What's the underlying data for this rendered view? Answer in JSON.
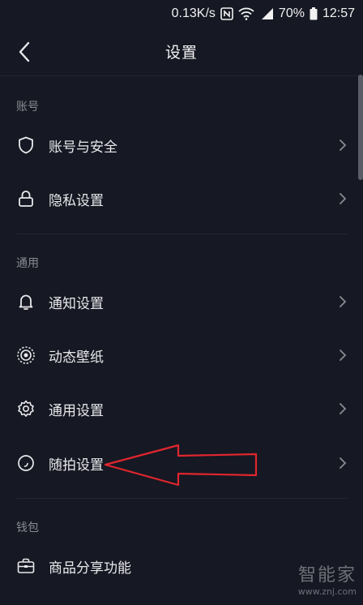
{
  "status_bar": {
    "speed": "0.13K/s",
    "battery": "70%",
    "time": "12:57",
    "icons": [
      "nfc-icon",
      "wifi-icon",
      "signal-icon",
      "battery-icon"
    ]
  },
  "nav": {
    "title": "设置",
    "back_icon": "chevron-left-icon"
  },
  "sections": [
    {
      "label": "账号",
      "items": [
        {
          "label": "账号与安全",
          "icon": "shield-icon"
        },
        {
          "label": "隐私设置",
          "icon": "lock-icon"
        }
      ]
    },
    {
      "label": "通用",
      "items": [
        {
          "label": "通知设置",
          "icon": "bell-icon"
        },
        {
          "label": "动态壁纸",
          "icon": "live-wallpaper-icon"
        },
        {
          "label": "通用设置",
          "icon": "gear-icon"
        },
        {
          "label": "随拍设置",
          "icon": "snapshot-icon"
        }
      ]
    },
    {
      "label": "钱包",
      "items": [
        {
          "label": "商品分享功能",
          "icon": "briefcase-icon"
        }
      ]
    }
  ],
  "annotation": {
    "color": "#e0262e"
  },
  "watermark": {
    "text": "智能家",
    "url": "www.znj.com"
  },
  "colors": {
    "background": "#161823",
    "text": "#e9e9ec",
    "muted": "#8a8b91"
  }
}
